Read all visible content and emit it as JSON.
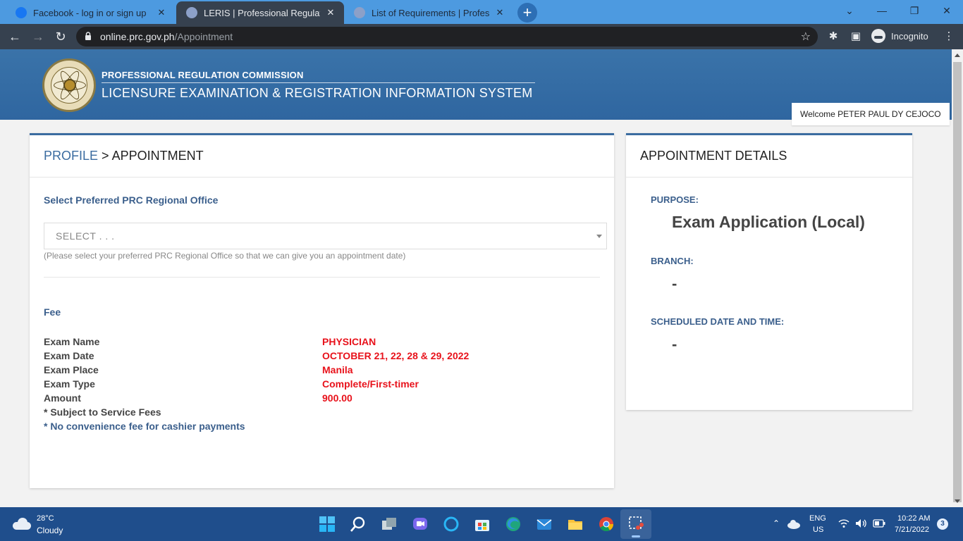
{
  "browser": {
    "tabs": [
      {
        "title": "Facebook - log in or sign up",
        "favicon_color": "#1877f2"
      },
      {
        "title": "LERIS | Professional Regulation C",
        "favicon_color": "#8ca0c8"
      },
      {
        "title": "List of Requirements | Professiona",
        "favicon_color": "#8ca0c8"
      }
    ],
    "new_tab_symbol": "+",
    "url_host": "online.prc.gov.ph",
    "url_path": "/Appointment",
    "profile_label": "Incognito"
  },
  "header": {
    "org_name": "PROFESSIONAL REGULATION COMMISSION",
    "system_name": "LICENSURE EXAMINATION & REGISTRATION INFORMATION SYSTEM",
    "welcome": "Welcome PETER PAUL DY CEJOCO"
  },
  "main": {
    "breadcrumb_link": "PROFILE",
    "breadcrumb_sep": " > ",
    "breadcrumb_current": "APPOINTMENT",
    "office_label": "Select Preferred PRC Regional Office",
    "office_placeholder": "SELECT . . .",
    "office_help": "(Please select your preferred PRC Regional Office so that we can give you an appointment date)",
    "fee_label": "Fee",
    "fee_rows": [
      {
        "key": "Exam Name",
        "value": "PHYSICIAN"
      },
      {
        "key": "Exam Date",
        "value": "OCTOBER 21, 22, 28 & 29, 2022"
      },
      {
        "key": "Exam Place",
        "value": "Manila"
      },
      {
        "key": "Exam Type",
        "value": "Complete/First-timer"
      },
      {
        "key": "Amount",
        "value": "900.00"
      }
    ],
    "note_service": "* Subject to Service Fees",
    "note_cashier": "* No convenience fee for cashier payments"
  },
  "details": {
    "title": "APPOINTMENT DETAILS",
    "purpose_label": "PURPOSE:",
    "purpose_value": "Exam Application (Local)",
    "branch_label": "BRANCH:",
    "branch_value": "-",
    "schedule_label": "SCHEDULED DATE AND TIME:",
    "schedule_value": "-"
  },
  "taskbar": {
    "temperature": "28°C",
    "condition": "Cloudy",
    "lang": "ENG",
    "region": "US",
    "time": "10:22 AM",
    "date": "7/21/2022",
    "notifications": "3"
  },
  "colors": {
    "brand_blue": "#3b6ca0",
    "value_red": "#e8121b",
    "tabbar": "#4d9ae0",
    "taskbar": "#1f4e8c"
  }
}
